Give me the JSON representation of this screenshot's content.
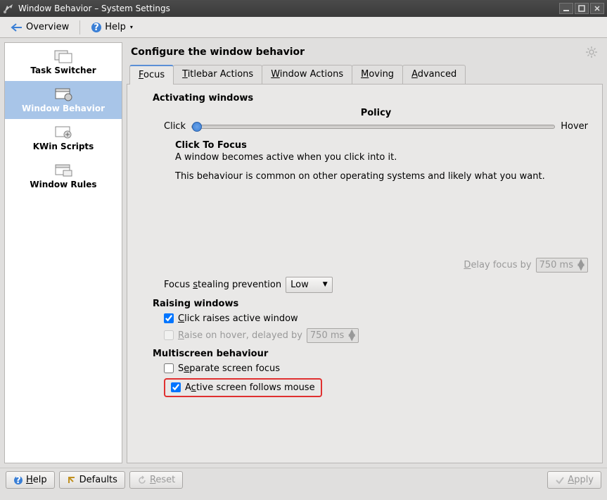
{
  "window": {
    "title": "Window Behavior – System Settings"
  },
  "toolbar": {
    "overview": "Overview",
    "help": "Help"
  },
  "sidebar": {
    "items": [
      {
        "label": "Task Switcher"
      },
      {
        "label": "Window Behavior"
      },
      {
        "label": "KWin Scripts"
      },
      {
        "label": "Window Rules"
      }
    ]
  },
  "content": {
    "heading": "Configure the window behavior",
    "tabs": [
      {
        "label": "Focus",
        "accel": "F"
      },
      {
        "label": "Titlebar Actions",
        "accel": "T"
      },
      {
        "label": "Window Actions",
        "accel": "W"
      },
      {
        "label": "Moving",
        "accel": "M"
      },
      {
        "label": "Advanced",
        "accel": "A"
      }
    ],
    "focus": {
      "activating_title": "Activating windows",
      "policy_label": "Policy",
      "slider_left": "Click",
      "slider_right": "Hover",
      "policy_name": "Click To Focus",
      "policy_desc1": "A window becomes active when you click into it.",
      "policy_desc2": "This behaviour is common on other operating systems and likely what you want.",
      "delay_focus_label": "Delay focus by",
      "delay_focus_value": "750 ms",
      "steal_label": "Focus stealing prevention",
      "steal_value": "Low",
      "raising_title": "Raising windows",
      "click_raises": "Click raises active window",
      "raise_hover": "Raise on hover, delayed by",
      "raise_hover_value": "750 ms",
      "multiscreen_title": "Multiscreen behaviour",
      "separate_screen": "Separate screen focus",
      "active_follows": "Active screen follows mouse"
    }
  },
  "buttons": {
    "help": "Help",
    "defaults": "Defaults",
    "reset": "Reset",
    "apply": "Apply"
  }
}
